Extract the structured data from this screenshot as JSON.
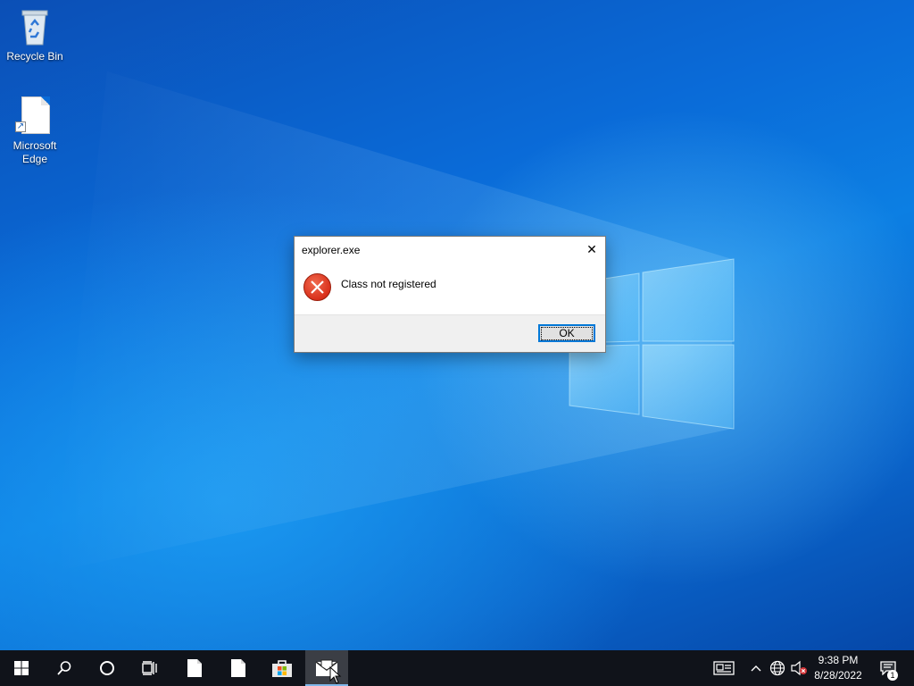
{
  "desktop": {
    "icons": [
      {
        "label": "Recycle Bin",
        "icon": "recycle-bin-icon"
      },
      {
        "label": "Microsoft\nEdge",
        "label_line1": "Microsoft",
        "label_line2": "Edge",
        "icon": "document-shortcut-icon"
      }
    ]
  },
  "dialog": {
    "title": "explorer.exe",
    "message": "Class not registered",
    "ok_label": "OK",
    "close_glyph": "✕",
    "icon": "error-icon"
  },
  "taskbar": {
    "buttons": [
      {
        "name": "start-button",
        "icon": "windows-logo-icon"
      },
      {
        "name": "search-button",
        "icon": "search-icon"
      },
      {
        "name": "cortana-button",
        "icon": "cortana-circle-icon"
      },
      {
        "name": "task-view-button",
        "icon": "task-view-icon"
      },
      {
        "name": "taskbar-app-file-1",
        "icon": "document-icon"
      },
      {
        "name": "taskbar-app-file-2",
        "icon": "document-icon"
      },
      {
        "name": "taskbar-app-store",
        "icon": "store-bag-icon"
      },
      {
        "name": "taskbar-app-mail",
        "icon": "mail-icon",
        "active": true
      }
    ],
    "tray": {
      "icons": [
        "news-icon",
        "chevron-up-icon",
        "network-globe-icon",
        "volume-muted-icon"
      ],
      "time": "9:38 PM",
      "date": "8/28/2022",
      "notification_count": "1"
    }
  },
  "colors": {
    "accent": "#0078d7",
    "taskbar": "#10131a",
    "error_red": "#d9301b"
  }
}
